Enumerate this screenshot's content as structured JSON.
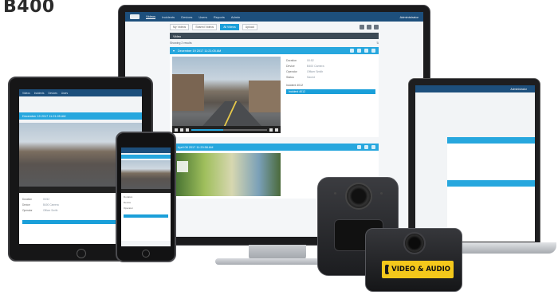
{
  "heading": "B400",
  "app": {
    "nav": [
      "Videos",
      "Incidents",
      "Devices",
      "Users",
      "Reports",
      "Admin"
    ],
    "user": "Administrator",
    "toolbar": [
      "My Videos",
      "Shared Videos",
      "All Videos",
      "Upload"
    ],
    "section_title": "Video",
    "result_count": "Showing 2 results",
    "recordings": [
      {
        "title": "December 19 2017 11:21:05 AM",
        "meta": [
          {
            "k": "Duration",
            "v": "00:52"
          },
          {
            "k": "Device",
            "v": "B400 Camera"
          },
          {
            "k": "Operator",
            "v": "Officer Smith"
          },
          {
            "k": "Status",
            "v": "Saved"
          }
        ],
        "associated_label": "Incident 4012",
        "associated_value": "Incident 4012",
        "progress": 0.42
      },
      {
        "title": "April 08 2017 11:20:58 AM"
      }
    ]
  },
  "laptop": {
    "user": "Administrator"
  },
  "camera_badge": "VIDEO & AUDIO"
}
